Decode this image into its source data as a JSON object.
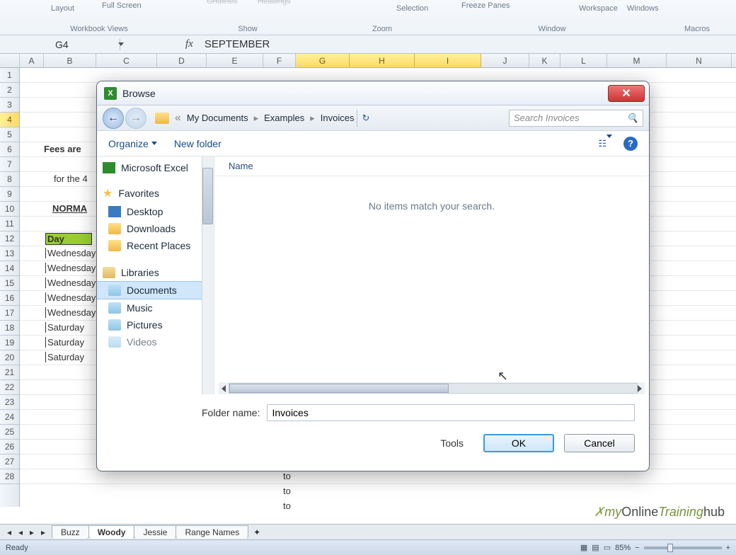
{
  "ribbon": {
    "layout": "Layout",
    "fullscreen": "Full Screen",
    "gridlines": "Gridlines",
    "headings": "Headings",
    "selection": "Selection",
    "freeze": "Freeze Panes",
    "workspace": "Workspace",
    "windows": "Windows",
    "groups": {
      "views": "Workbook Views",
      "show": "Show",
      "zoom": "Zoom",
      "window": "Window",
      "macros": "Macros"
    }
  },
  "namebox": "G4",
  "formula": "SEPTEMBER",
  "columns": [
    "A",
    "B",
    "C",
    "D",
    "E",
    "F",
    "G",
    "H",
    "I",
    "J",
    "K",
    "L",
    "M",
    "N"
  ],
  "col_selected": [
    "G",
    "H",
    "I"
  ],
  "rows_count": 28,
  "row_selected": 4,
  "cells": {
    "fees": "Fees are",
    "forthe": "for the 4",
    "norma": "NORMA",
    "day": "Day",
    "days": [
      "Wednesday",
      "Wednesday",
      "Wednesday",
      "Wednesday",
      "Wednesday",
      "Saturday",
      "Saturday",
      "Saturday"
    ],
    "to": "to"
  },
  "sheet_tabs": {
    "t1": "Buzz",
    "t2": "Woody",
    "t3": "Jessie",
    "t4": "Range Names"
  },
  "status": {
    "ready": "Ready",
    "zoom": "85%"
  },
  "dialog": {
    "title": "Browse",
    "crumbs": {
      "root": "My Documents",
      "c2": "Examples",
      "c3": "Invoices"
    },
    "search_placeholder": "Search Invoices",
    "organize": "Organize",
    "newfolder": "New folder",
    "side": {
      "excel": "Microsoft Excel",
      "fav": "Favorites",
      "desktop": "Desktop",
      "downloads": "Downloads",
      "recent": "Recent Places",
      "lib": "Libraries",
      "docs": "Documents",
      "music": "Music",
      "pics": "Pictures",
      "vids": "Videos"
    },
    "name_col": "Name",
    "empty": "No items match your search.",
    "folder_label": "Folder name:",
    "folder_value": "Invoices",
    "tools": "Tools",
    "ok": "OK",
    "cancel": "Cancel"
  },
  "logo": {
    "a": "my",
    "b": "Online",
    "c": "Training",
    "d": "hub"
  }
}
